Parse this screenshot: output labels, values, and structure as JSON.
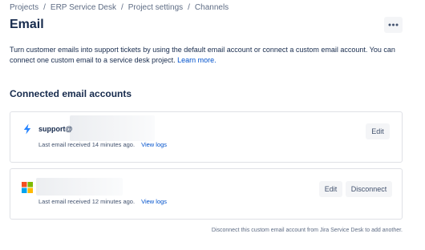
{
  "breadcrumb": [
    "Projects",
    "ERP Service Desk",
    "Project settings",
    "Channels"
  ],
  "breadcrumb_separator": "/",
  "page_title": "Email",
  "description": {
    "text": "Turn customer emails into support tickets by using the default email account or connect a custom email account. You can connect one custom email to a service desk project.",
    "link": "Learn more."
  },
  "section_heading": "Connected email accounts",
  "accounts": [
    {
      "icon": "lightning-bolt-icon",
      "name": "support@",
      "last_email": "Last email received 14 minutes ago.",
      "view_logs": "View logs",
      "edit_label": "Edit"
    },
    {
      "icon": "microsoft-logo-icon",
      "name": "",
      "last_email": "Last email received 12 minutes ago.",
      "view_logs": "View logs",
      "edit_label": "Edit",
      "disconnect_label": "Disconnect"
    }
  ],
  "footer_note": "Disconnect this custom email account from Jira Service Desk to add another.",
  "colors": {
    "link": "#0052cc",
    "text": "#172b4d",
    "bolt": "#2684ff"
  }
}
